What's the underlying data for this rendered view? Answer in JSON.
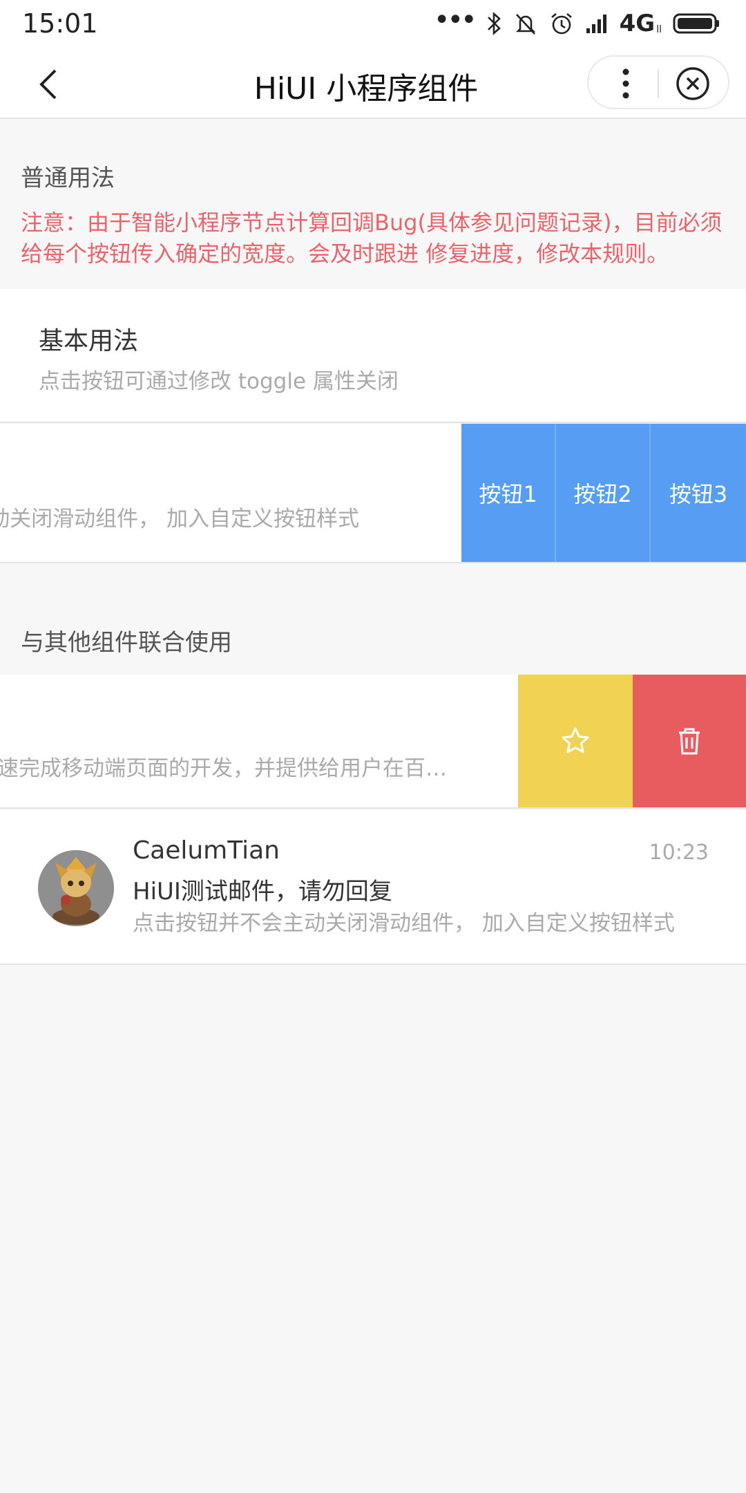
{
  "status": {
    "time": "15:01",
    "network": "4G",
    "network_sub": "ll",
    "icons": [
      "more-dots-icon",
      "bluetooth-icon",
      "mute-icon",
      "alarm-icon",
      "signal-icon",
      "battery-icon"
    ]
  },
  "nav": {
    "title": "HiUI  小程序组件"
  },
  "section1": {
    "title": "普通用法",
    "notice": "注意：由于智能小程序节点计算回调Bug(具体参见问题记录)，目前必须给每个按钮传入确定的宽度。会及时跟进 修复进度，修改本规则。"
  },
  "basic": {
    "title": "基本用法",
    "desc": "点击按钮可通过修改 toggle 属性关闭"
  },
  "swipe1": {
    "desc": "点击按钮并不会主动关闭滑动组件， 加入自定义按钮样式",
    "buttons": [
      "按钮1",
      "按钮2",
      "按钮3"
    ]
  },
  "section2": {
    "title": "与其他组件联合使用"
  },
  "swipe2": {
    "desc": "HiUI 小程序组件帮助开发者快速完成移动端页面的开发，并提供给用户在百度智能小程序中一致的体验"
  },
  "mail": {
    "name": "CaelumTian",
    "time": "10:23",
    "subject": "HiUI测试邮件，请勿回复",
    "preview": "点击按钮并不会主动关闭滑动组件， 加入自定义按钮样式"
  },
  "colors": {
    "blue": "#569df3",
    "yellow": "#f1d253",
    "red": "#e85c5f",
    "notice": "#e8636c"
  }
}
